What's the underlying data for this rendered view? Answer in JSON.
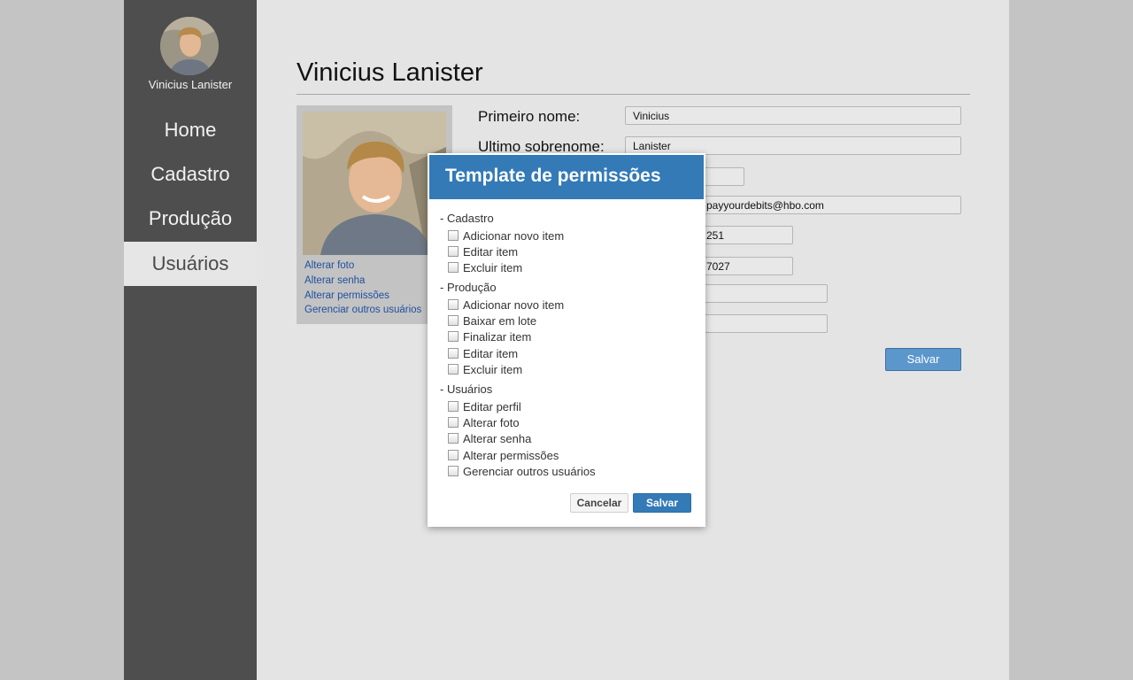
{
  "user": {
    "name": "Vinicius Lanister"
  },
  "nav": {
    "items": [
      {
        "label": "Home"
      },
      {
        "label": "Cadastro"
      },
      {
        "label": "Produção"
      },
      {
        "label": "Usuários",
        "active": true
      }
    ]
  },
  "page": {
    "title": "Vinicius Lanister"
  },
  "photo_panel": {
    "links": [
      "Alterar foto",
      "Alterar senha",
      "Alterar permissões",
      "Gerenciar outros usuários"
    ]
  },
  "form": {
    "first_name_label": "Primeiro nome:",
    "first_name_value": "Vinicius",
    "last_name_label": "Ultimo sobrenome:",
    "last_name_value": "Lanister",
    "email_value": "payyourdebits@hbo.com",
    "phone1_value": "251",
    "phone2_value": "7027",
    "save_label": "Salvar"
  },
  "modal": {
    "title": "Template de permissões",
    "groups": [
      {
        "title": "- Cadastro",
        "items": [
          "Adicionar novo item",
          "Editar item",
          "Excluir item"
        ]
      },
      {
        "title": "- Produção",
        "items": [
          "Adicionar novo item",
          "Baixar em lote",
          "Finalizar item",
          "Editar item",
          "Excluir item"
        ]
      },
      {
        "title": "- Usuários",
        "items": [
          "Editar perfil",
          "Alterar foto",
          "Alterar senha",
          "Alterar permissões",
          "Gerenciar outros usuários"
        ]
      }
    ],
    "cancel_label": "Cancelar",
    "save_label": "Salvar"
  },
  "colors": {
    "sidebar_bg": "#4e4e4e",
    "accent": "#337ab7",
    "link": "#1e4f9e"
  }
}
